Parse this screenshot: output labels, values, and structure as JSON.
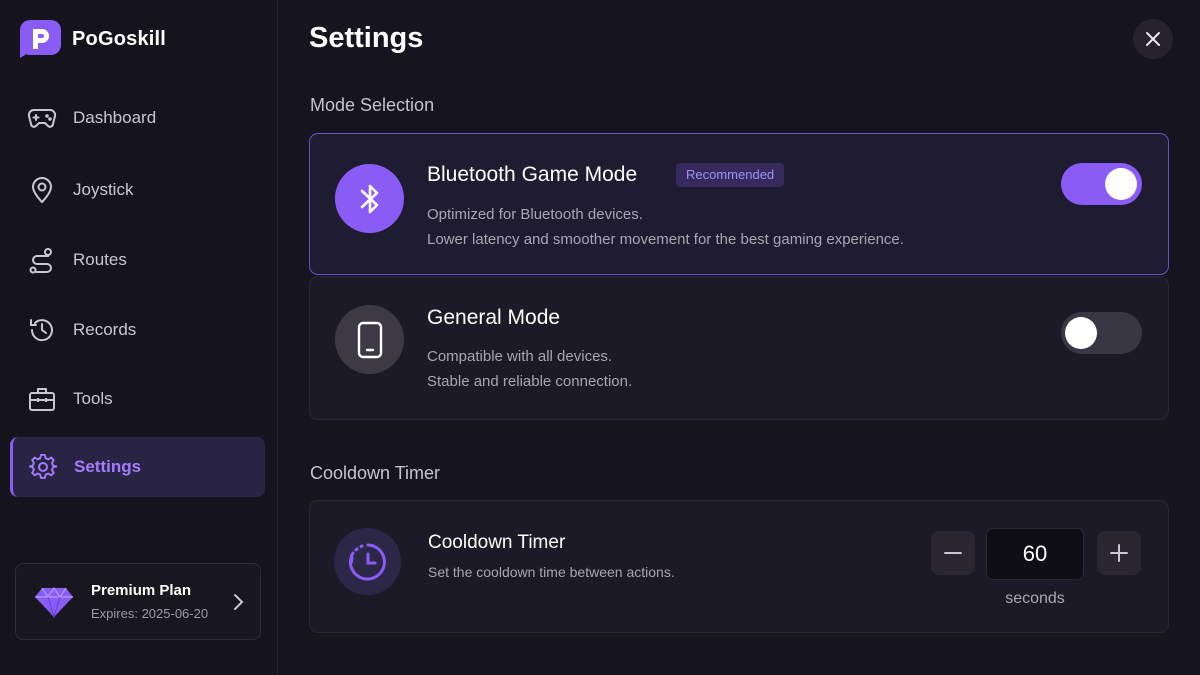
{
  "brand": {
    "name": "PoGoskill"
  },
  "sidebar": {
    "items": [
      {
        "label": "Dashboard",
        "icon": "gamepad-icon",
        "active": false
      },
      {
        "label": "Joystick",
        "icon": "location-pin-icon",
        "active": false
      },
      {
        "label": "Routes",
        "icon": "route-icon",
        "active": false
      },
      {
        "label": "Records",
        "icon": "history-icon",
        "active": false
      },
      {
        "label": "Tools",
        "icon": "toolbox-icon",
        "active": false
      },
      {
        "label": "Settings",
        "icon": "gear-icon",
        "active": true
      }
    ],
    "plan": {
      "title": "Premium Plan",
      "expiry": "Expires: 2025-06-20",
      "icon": "diamond-icon"
    }
  },
  "page": {
    "title": "Settings",
    "close_icon": "close-icon"
  },
  "mode_selection": {
    "section_title": "Mode Selection",
    "modes": [
      {
        "title": "Bluetooth Game Mode",
        "badge": "Recommended",
        "desc_line1": "Optimized for Bluetooth devices.",
        "desc_line2": "Lower latency and smoother movement for the best gaming experience.",
        "enabled": true,
        "icon": "bluetooth-icon"
      },
      {
        "title": "General Mode",
        "desc_line1": "Compatible with all devices.",
        "desc_line2": "Stable and reliable connection.",
        "enabled": false,
        "icon": "phone-icon"
      }
    ]
  },
  "cooldown": {
    "section_title": "Cooldown Timer",
    "title": "Cooldown Timer",
    "desc": "Set the cooldown time between actions.",
    "value": "60",
    "unit": "seconds",
    "icon": "timer-icon"
  },
  "colors": {
    "accent": "#8a5cf6",
    "background": "#16141f",
    "card": "#1c1a26",
    "selected_card": "#1f1b31"
  }
}
